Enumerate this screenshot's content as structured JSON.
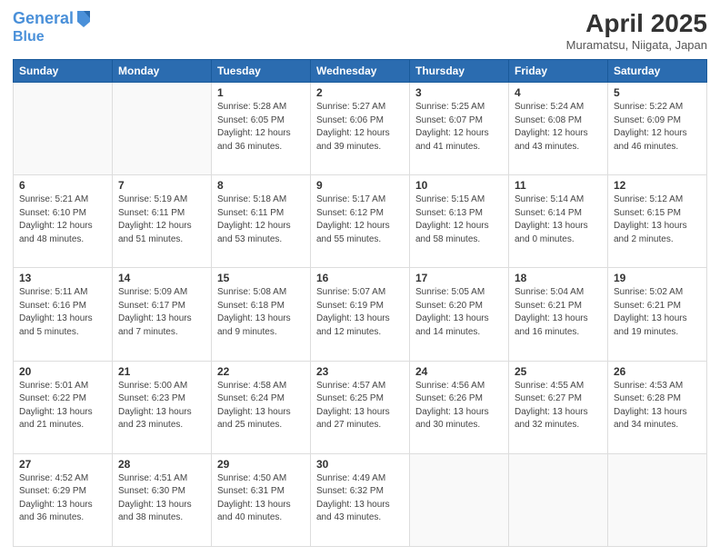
{
  "logo": {
    "line1": "General",
    "line2": "Blue"
  },
  "title": "April 2025",
  "location": "Muramatsu, Niigata, Japan",
  "days_of_week": [
    "Sunday",
    "Monday",
    "Tuesday",
    "Wednesday",
    "Thursday",
    "Friday",
    "Saturday"
  ],
  "weeks": [
    [
      {
        "day": "",
        "detail": ""
      },
      {
        "day": "",
        "detail": ""
      },
      {
        "day": "1",
        "detail": "Sunrise: 5:28 AM\nSunset: 6:05 PM\nDaylight: 12 hours\nand 36 minutes."
      },
      {
        "day": "2",
        "detail": "Sunrise: 5:27 AM\nSunset: 6:06 PM\nDaylight: 12 hours\nand 39 minutes."
      },
      {
        "day": "3",
        "detail": "Sunrise: 5:25 AM\nSunset: 6:07 PM\nDaylight: 12 hours\nand 41 minutes."
      },
      {
        "day": "4",
        "detail": "Sunrise: 5:24 AM\nSunset: 6:08 PM\nDaylight: 12 hours\nand 43 minutes."
      },
      {
        "day": "5",
        "detail": "Sunrise: 5:22 AM\nSunset: 6:09 PM\nDaylight: 12 hours\nand 46 minutes."
      }
    ],
    [
      {
        "day": "6",
        "detail": "Sunrise: 5:21 AM\nSunset: 6:10 PM\nDaylight: 12 hours\nand 48 minutes."
      },
      {
        "day": "7",
        "detail": "Sunrise: 5:19 AM\nSunset: 6:11 PM\nDaylight: 12 hours\nand 51 minutes."
      },
      {
        "day": "8",
        "detail": "Sunrise: 5:18 AM\nSunset: 6:11 PM\nDaylight: 12 hours\nand 53 minutes."
      },
      {
        "day": "9",
        "detail": "Sunrise: 5:17 AM\nSunset: 6:12 PM\nDaylight: 12 hours\nand 55 minutes."
      },
      {
        "day": "10",
        "detail": "Sunrise: 5:15 AM\nSunset: 6:13 PM\nDaylight: 12 hours\nand 58 minutes."
      },
      {
        "day": "11",
        "detail": "Sunrise: 5:14 AM\nSunset: 6:14 PM\nDaylight: 13 hours\nand 0 minutes."
      },
      {
        "day": "12",
        "detail": "Sunrise: 5:12 AM\nSunset: 6:15 PM\nDaylight: 13 hours\nand 2 minutes."
      }
    ],
    [
      {
        "day": "13",
        "detail": "Sunrise: 5:11 AM\nSunset: 6:16 PM\nDaylight: 13 hours\nand 5 minutes."
      },
      {
        "day": "14",
        "detail": "Sunrise: 5:09 AM\nSunset: 6:17 PM\nDaylight: 13 hours\nand 7 minutes."
      },
      {
        "day": "15",
        "detail": "Sunrise: 5:08 AM\nSunset: 6:18 PM\nDaylight: 13 hours\nand 9 minutes."
      },
      {
        "day": "16",
        "detail": "Sunrise: 5:07 AM\nSunset: 6:19 PM\nDaylight: 13 hours\nand 12 minutes."
      },
      {
        "day": "17",
        "detail": "Sunrise: 5:05 AM\nSunset: 6:20 PM\nDaylight: 13 hours\nand 14 minutes."
      },
      {
        "day": "18",
        "detail": "Sunrise: 5:04 AM\nSunset: 6:21 PM\nDaylight: 13 hours\nand 16 minutes."
      },
      {
        "day": "19",
        "detail": "Sunrise: 5:02 AM\nSunset: 6:21 PM\nDaylight: 13 hours\nand 19 minutes."
      }
    ],
    [
      {
        "day": "20",
        "detail": "Sunrise: 5:01 AM\nSunset: 6:22 PM\nDaylight: 13 hours\nand 21 minutes."
      },
      {
        "day": "21",
        "detail": "Sunrise: 5:00 AM\nSunset: 6:23 PM\nDaylight: 13 hours\nand 23 minutes."
      },
      {
        "day": "22",
        "detail": "Sunrise: 4:58 AM\nSunset: 6:24 PM\nDaylight: 13 hours\nand 25 minutes."
      },
      {
        "day": "23",
        "detail": "Sunrise: 4:57 AM\nSunset: 6:25 PM\nDaylight: 13 hours\nand 27 minutes."
      },
      {
        "day": "24",
        "detail": "Sunrise: 4:56 AM\nSunset: 6:26 PM\nDaylight: 13 hours\nand 30 minutes."
      },
      {
        "day": "25",
        "detail": "Sunrise: 4:55 AM\nSunset: 6:27 PM\nDaylight: 13 hours\nand 32 minutes."
      },
      {
        "day": "26",
        "detail": "Sunrise: 4:53 AM\nSunset: 6:28 PM\nDaylight: 13 hours\nand 34 minutes."
      }
    ],
    [
      {
        "day": "27",
        "detail": "Sunrise: 4:52 AM\nSunset: 6:29 PM\nDaylight: 13 hours\nand 36 minutes."
      },
      {
        "day": "28",
        "detail": "Sunrise: 4:51 AM\nSunset: 6:30 PM\nDaylight: 13 hours\nand 38 minutes."
      },
      {
        "day": "29",
        "detail": "Sunrise: 4:50 AM\nSunset: 6:31 PM\nDaylight: 13 hours\nand 40 minutes."
      },
      {
        "day": "30",
        "detail": "Sunrise: 4:49 AM\nSunset: 6:32 PM\nDaylight: 13 hours\nand 43 minutes."
      },
      {
        "day": "",
        "detail": ""
      },
      {
        "day": "",
        "detail": ""
      },
      {
        "day": "",
        "detail": ""
      }
    ]
  ]
}
